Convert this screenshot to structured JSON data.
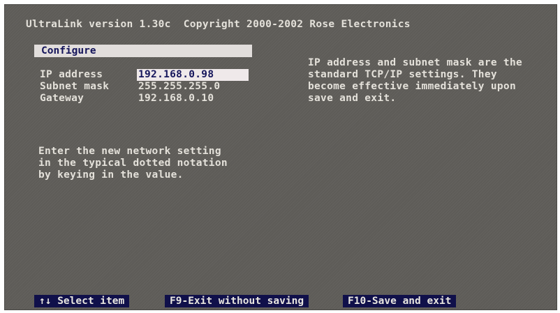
{
  "header": {
    "title": "UltraLink version 1.30c  Copyright 2000-2002 Rose Electronics"
  },
  "configure": {
    "section_label": "Configure",
    "fields": [
      {
        "label": "IP address",
        "value": "192.168.0.98",
        "selected": true
      },
      {
        "label": "Subnet mask",
        "value": "255.255.255.0",
        "selected": false
      },
      {
        "label": "Gateway",
        "value": "192.168.0.10",
        "selected": false
      }
    ]
  },
  "help_right": {
    "lines": [
      "IP address and subnet mask are the",
      "standard TCP/IP settings. They",
      "become effective immediately upon",
      "save and exit."
    ]
  },
  "help_left": {
    "lines": [
      "Enter the new network setting",
      "in the typical dotted notation",
      "by keying in the value."
    ]
  },
  "function_keys": [
    {
      "label": "↑↓ Select item"
    },
    {
      "label": "F9-Exit without saving"
    },
    {
      "label": "F10-Save and exit"
    }
  ],
  "colors": {
    "screen_background": "#5e5c58",
    "text": "#e4e1da",
    "highlight_background": "#e2dedc",
    "highlight_text": "#14145a",
    "fkey_background": "#10104a"
  }
}
